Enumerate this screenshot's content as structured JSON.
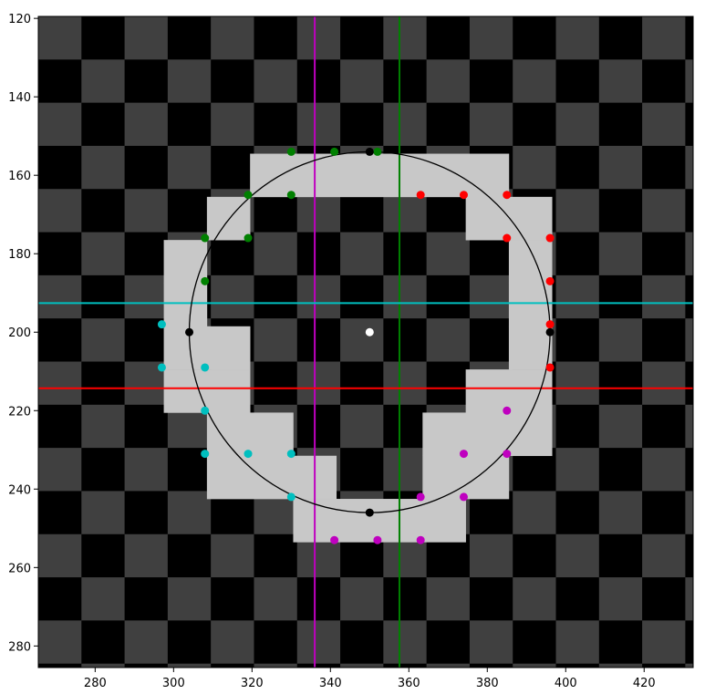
{
  "chart_data": {
    "type": "scatter",
    "title": "",
    "xlabel": "",
    "ylabel": "",
    "xlim": [
      265.5,
      432.5
    ],
    "ylim": [
      285.5,
      119.5
    ],
    "y_inverted": true,
    "xticks": [
      280,
      300,
      320,
      340,
      360,
      380,
      400,
      420
    ],
    "yticks": [
      120,
      140,
      160,
      180,
      200,
      220,
      240,
      260,
      280
    ],
    "background": {
      "checker_cell_size": 11,
      "checker_origin": [
        265.5,
        119.5
      ],
      "dark_color": "#000000",
      "light_color": "#404040",
      "ring_color": "#c8c8c8",
      "ring_rects": [
        [
          319.5,
          154.5,
          385.5,
          165.5
        ],
        [
          308.5,
          165.5,
          319.5,
          176.5
        ],
        [
          374.5,
          165.5,
          396.5,
          176.5
        ],
        [
          297.5,
          176.5,
          308.5,
          187.5
        ],
        [
          385.5,
          176.5,
          396.5,
          187.5
        ],
        [
          297.5,
          187.5,
          308.5,
          198.5
        ],
        [
          385.5,
          187.5,
          396.5,
          198.5
        ],
        [
          297.5,
          198.5,
          319.5,
          209.5
        ],
        [
          385.5,
          198.5,
          396.5,
          209.5
        ],
        [
          297.5,
          209.5,
          319.5,
          220.5
        ],
        [
          374.5,
          209.5,
          396.5,
          220.5
        ],
        [
          308.5,
          220.5,
          330.5,
          231.5
        ],
        [
          363.5,
          220.5,
          396.5,
          231.5
        ],
        [
          308.5,
          231.5,
          341.5,
          242.5
        ],
        [
          363.5,
          231.5,
          385.5,
          242.5
        ],
        [
          330.5,
          242.5,
          374.5,
          253.5
        ]
      ]
    },
    "circle": {
      "center": [
        350,
        200
      ],
      "radius": 46,
      "color": "#000000"
    },
    "center_point": {
      "x": 350,
      "y": 200,
      "color": "#ffffff"
    },
    "extreme_points": {
      "color": "#000000",
      "points": [
        [
          350,
          154
        ],
        [
          350,
          246
        ],
        [
          304,
          200
        ],
        [
          396,
          200
        ]
      ]
    },
    "lines": [
      {
        "orientation": "vertical",
        "value": 336,
        "color": "#bf00bf"
      },
      {
        "orientation": "vertical",
        "value": 357.6,
        "color": "#008000"
      },
      {
        "orientation": "horizontal",
        "value": 192.6,
        "color": "#00bfbf"
      },
      {
        "orientation": "horizontal",
        "value": 214.3,
        "color": "#ff0000"
      }
    ],
    "series": [
      {
        "color": "#008000",
        "points": [
          [
            330,
            154
          ],
          [
            341,
            154
          ],
          [
            352,
            154
          ],
          [
            319,
            165
          ],
          [
            330,
            165
          ],
          [
            308,
            176
          ],
          [
            319,
            176
          ],
          [
            308,
            187
          ]
        ]
      },
      {
        "color": "#ff0000",
        "points": [
          [
            363,
            165
          ],
          [
            374,
            165
          ],
          [
            385,
            165
          ],
          [
            385,
            176
          ],
          [
            396,
            176
          ],
          [
            396,
            187
          ],
          [
            396,
            198
          ],
          [
            396,
            209
          ]
        ]
      },
      {
        "color": "#00bfbf",
        "points": [
          [
            297,
            198
          ],
          [
            297,
            209
          ],
          [
            308,
            209
          ],
          [
            308,
            220
          ],
          [
            308,
            231
          ],
          [
            319,
            231
          ],
          [
            330,
            231
          ],
          [
            330,
            242
          ]
        ]
      },
      {
        "color": "#bf00bf",
        "points": [
          [
            385,
            220
          ],
          [
            374,
            231
          ],
          [
            385,
            231
          ],
          [
            363,
            242
          ],
          [
            374,
            242
          ],
          [
            341,
            253
          ],
          [
            352,
            253
          ],
          [
            363,
            253
          ]
        ]
      }
    ]
  }
}
